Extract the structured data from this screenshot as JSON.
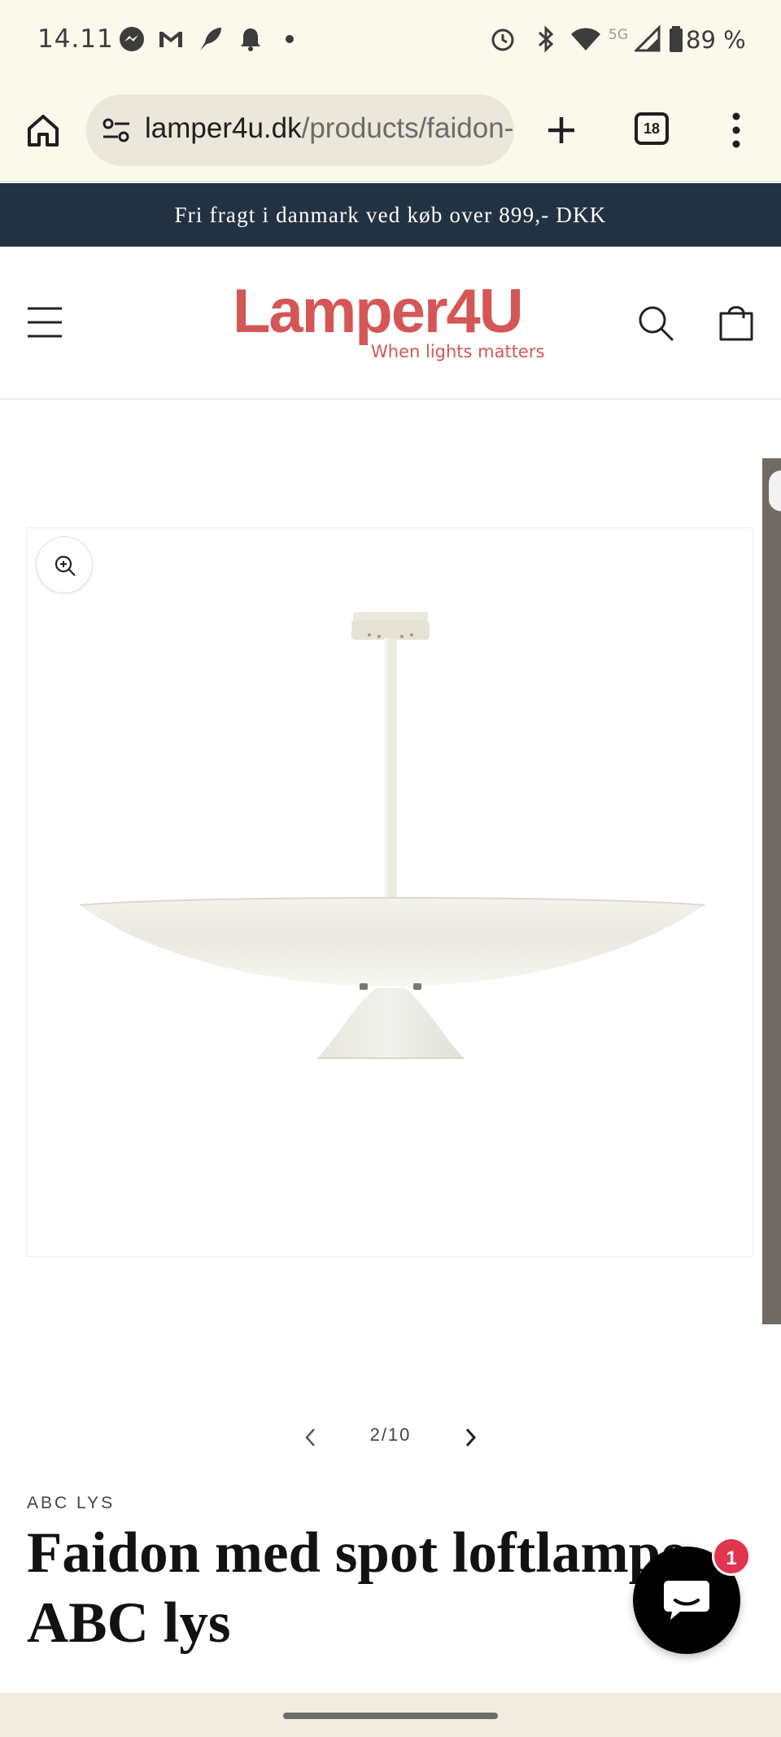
{
  "status_bar": {
    "time": "14.11",
    "network": "5G",
    "battery": "89 %"
  },
  "browser": {
    "url_domain": "lamper4u.dk",
    "url_path": "/products/faidon-med-spot-loftlampe-abc-lys",
    "tab_count": "18"
  },
  "announcement": {
    "text": "Fri fragt i danmark ved køb over 899,- DKK"
  },
  "header": {
    "logo_main": "Lamper4U",
    "logo_tagline": "When lights matters"
  },
  "gallery": {
    "counter": "2/10"
  },
  "product": {
    "vendor": "ABC LYS",
    "title": "Faidon med spot loftlampe ABC lys"
  },
  "chat": {
    "badge_count": "1"
  },
  "colors": {
    "announcement_bg": "#233242",
    "logo": "#d45656",
    "chat_badge": "#e0344f"
  }
}
